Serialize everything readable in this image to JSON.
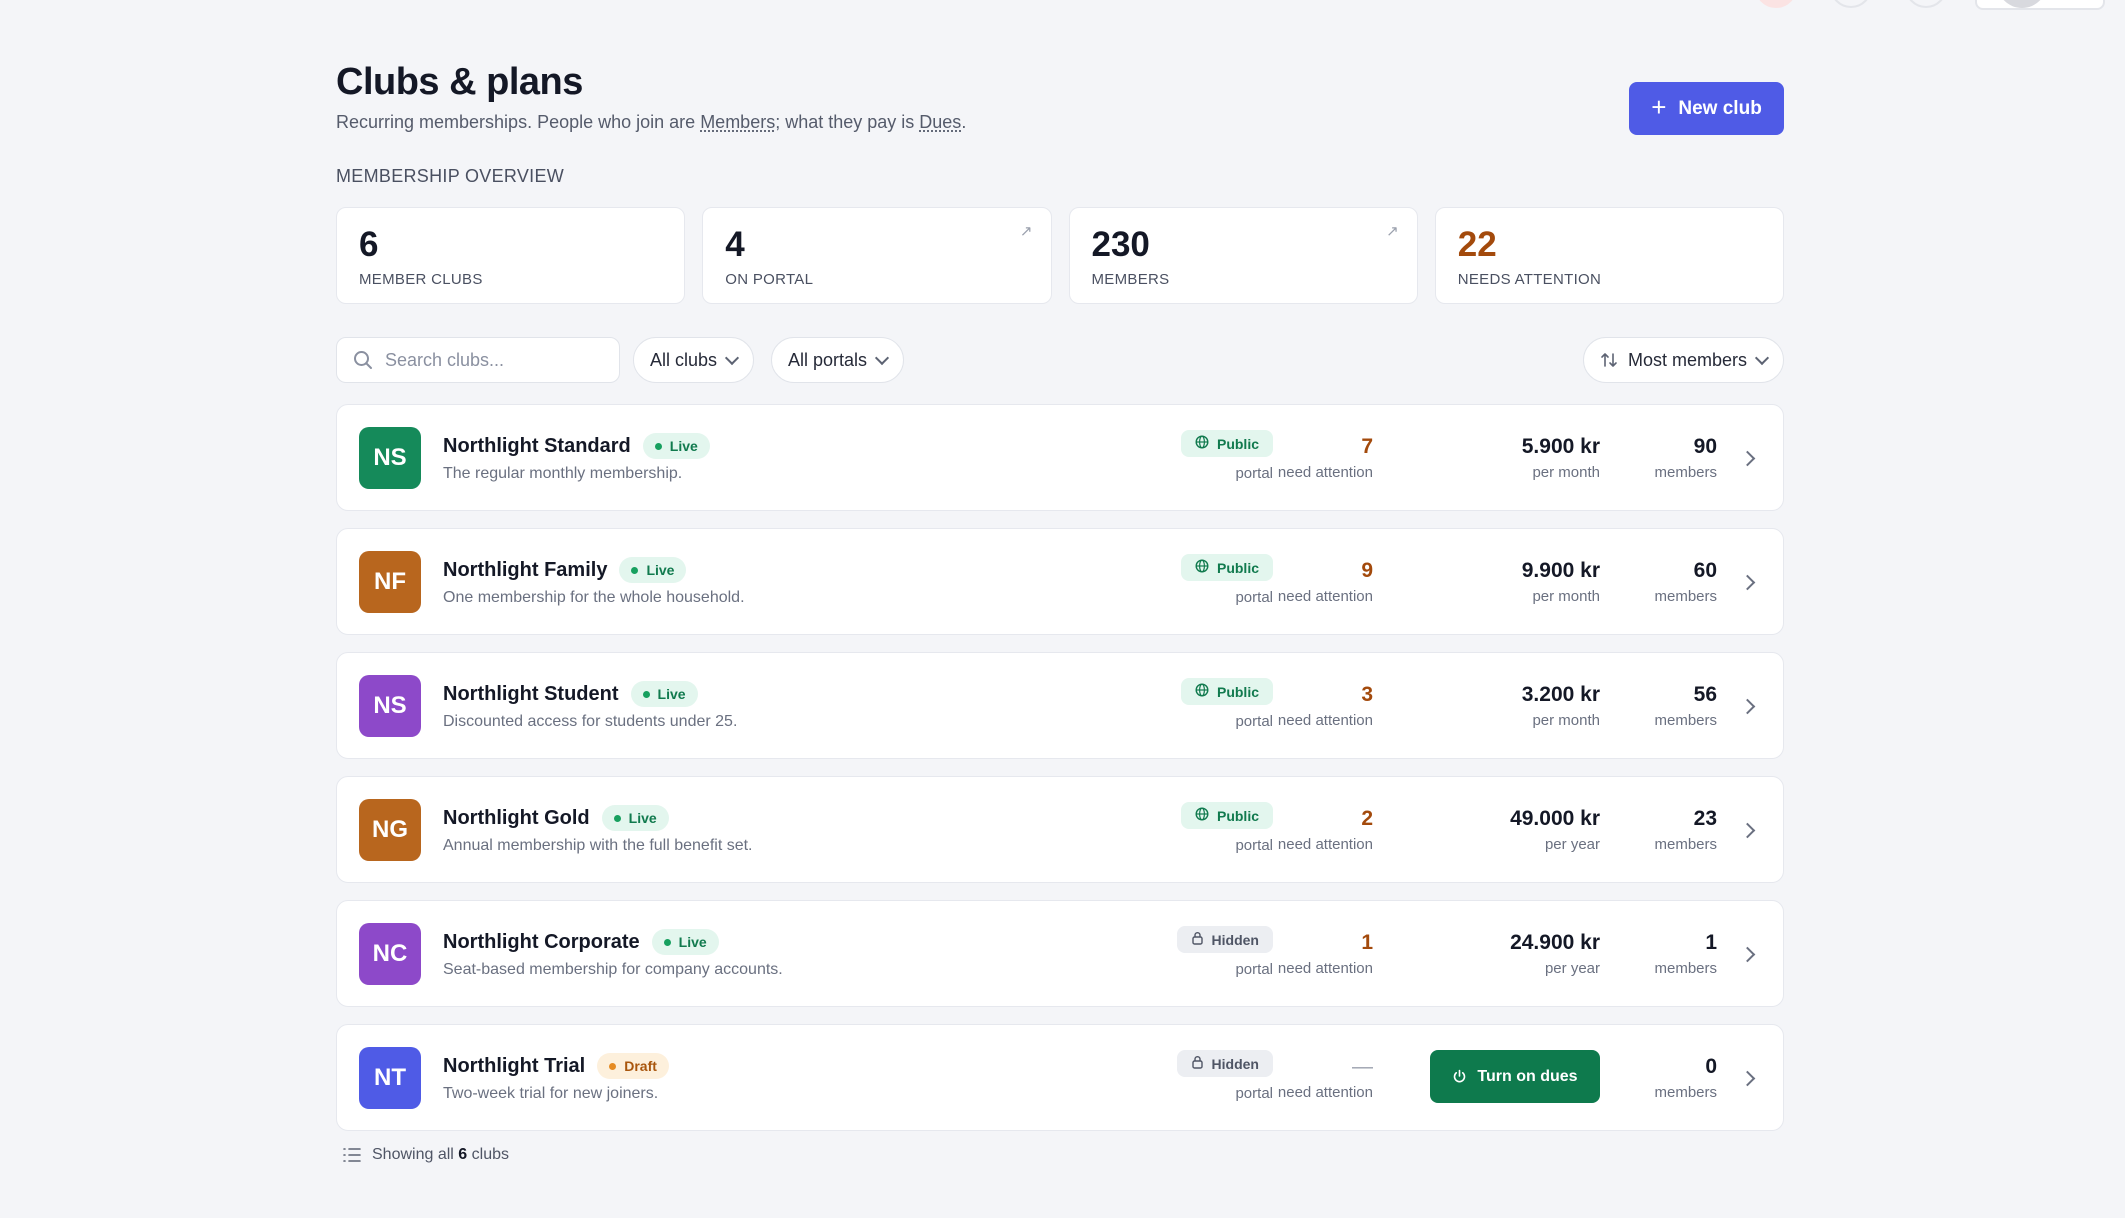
{
  "header": {
    "title": "Clubs & plans",
    "subtitle_prefix": "Recurring memberships. People who join are ",
    "subtitle_term_members": "Members",
    "subtitle_middle": "; what they pay is ",
    "subtitle_term_dues": "Dues",
    "subtitle_suffix": ".",
    "new_club_label": "New club"
  },
  "overview": {
    "section_label": "MEMBERSHIP OVERVIEW",
    "stats": [
      {
        "value": "6",
        "label": "MEMBER CLUBS"
      },
      {
        "value": "4",
        "label": "ON PORTAL",
        "arrow": "↗"
      },
      {
        "value": "230",
        "label": "MEMBERS",
        "arrow": "↗"
      },
      {
        "value": "22",
        "label": "NEEDS ATTENTION"
      }
    ]
  },
  "toolbar": {
    "search_placeholder": "Search clubs...",
    "filter_clubs": "All clubs",
    "filter_portals": "All portals",
    "sort": "Most members"
  },
  "clubs": [
    {
      "initials": "NS",
      "color": "#158a5a",
      "name": "Northlight Standard",
      "status": "Live",
      "description": "The regular monthly membership.",
      "portal": "Public",
      "portal_sub": "portal",
      "attention": "7",
      "attention_label": "need attention",
      "price": "5.900 kr",
      "period": "per month",
      "members": "90",
      "members_label": "members"
    },
    {
      "initials": "NF",
      "color": "#b8661e",
      "name": "Northlight Family",
      "status": "Live",
      "description": "One membership for the whole household.",
      "portal": "Public",
      "portal_sub": "portal",
      "attention": "9",
      "attention_label": "need attention",
      "price": "9.900 kr",
      "period": "per month",
      "members": "60",
      "members_label": "members"
    },
    {
      "initials": "NS",
      "color": "#8d49c9",
      "name": "Northlight Student",
      "status": "Live",
      "description": "Discounted access for students under 25.",
      "portal": "Public",
      "portal_sub": "portal",
      "attention": "3",
      "attention_label": "need attention",
      "price": "3.200 kr",
      "period": "per month",
      "members": "56",
      "members_label": "members"
    },
    {
      "initials": "NG",
      "color": "#b8661e",
      "name": "Northlight Gold",
      "status": "Live",
      "description": "Annual membership with the full benefit set.",
      "portal": "Public",
      "portal_sub": "portal",
      "attention": "2",
      "attention_label": "need attention",
      "price": "49.000 kr",
      "period": "per year",
      "members": "23",
      "members_label": "members"
    },
    {
      "initials": "NC",
      "color": "#8d49c9",
      "name": "Northlight Corporate",
      "status": "Live",
      "description": "Seat-based membership for company accounts.",
      "portal": "Hidden",
      "portal_sub": "portal",
      "attention": "1",
      "attention_label": "need attention",
      "price": "24.900 kr",
      "period": "per year",
      "members": "1",
      "members_label": "members"
    },
    {
      "initials": "NT",
      "color": "#4f5be6",
      "name": "Northlight Trial",
      "status": "Draft",
      "description": "Two-week trial for new joiners.",
      "portal": "Hidden",
      "portal_sub": "portal",
      "attention": "—",
      "attention_label": "need attention",
      "action_label": "Turn on dues",
      "members": "0",
      "members_label": "members"
    }
  ],
  "footer": {
    "prefix": "Showing all ",
    "count": "6",
    "suffix": " clubs"
  },
  "colors": {
    "accent": "#4f5be6",
    "live": "#117a4e",
    "draft": "#a9560d",
    "attention": "#a34a0c"
  }
}
